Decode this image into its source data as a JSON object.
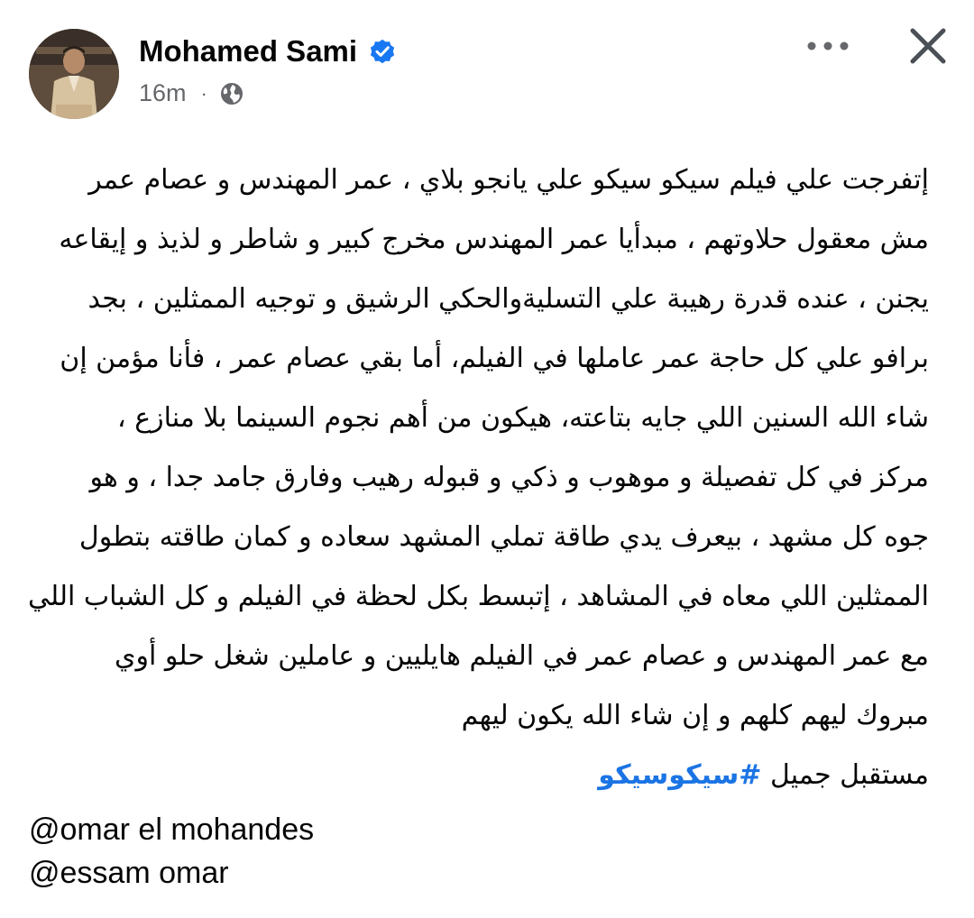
{
  "post": {
    "author": {
      "name": "Mohamed Sami",
      "verified": true
    },
    "time": "16m",
    "separator": "·",
    "audience_icon": "globe-icon",
    "actions": {
      "more_icon": "more-options-icon",
      "close_icon": "close-icon"
    },
    "text_lines": [
      "إتفرجت علي فيلم سيكو سيكو علي يانجو بلاي ، عمر المهندس و عصام عمر",
      "مش معقول حلاوتهم ، مبدأيا عمر المهندس مخرج كبير و شاطر و لذيذ و إيقاعه",
      "يجنن ، عنده قدرة رهيبة علي التسليةوالحكي الرشيق و توجيه الممثلين ، بجد",
      "برافو علي كل حاجة عمر عاملها في الفيلم،  أما بقي عصام عمر ، فأنا  مؤمن  إن",
      "شاء الله السنين اللي جايه بتاعته،  هيكون من أهم نجوم السينما بلا منازع ،",
      "مركز في كل تفصيلة و موهوب و ذكي و قبوله رهيب وفارق جامد جدا ، و هو",
      "جوه كل مشهد ، بيعرف يدي طاقة تملي المشهد سعاده و كمان طاقته بتطول",
      "الممثلين اللي معاه في المشاهد ، إتبسط بكل لحظة في الفيلم و كل الشباب اللي",
      "مع عمر المهندس و عصام عمر في الفيلم هايليين و عاملين شغل حلو أوي",
      "مبروك ليهم كلهم و إن شاء الله يكون ليهم"
    ],
    "last_line_prefix": "مستقبل جميل",
    "hashtag": "#سيكوسيكو",
    "mentions": [
      "@omar el mohandes",
      "@essam omar"
    ]
  },
  "colors": {
    "verified": "#1877f2",
    "hashtag": "#1b74e4",
    "meta": "#65676b",
    "text": "#050505"
  }
}
